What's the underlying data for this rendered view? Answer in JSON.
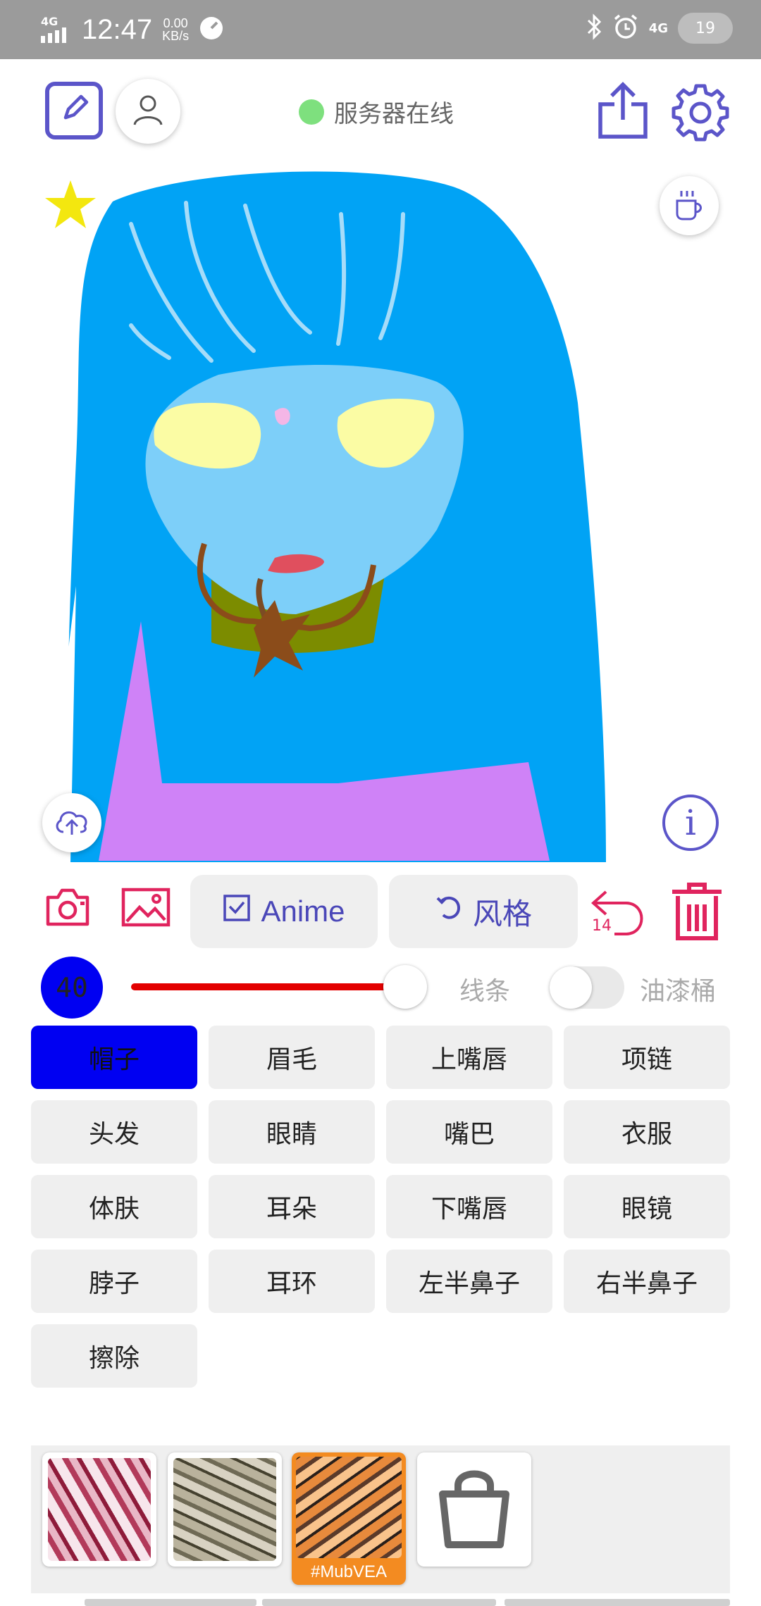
{
  "status_bar": {
    "network": "4G",
    "time": "12:47",
    "speed_value": "0.00",
    "speed_unit": "KB/s",
    "network_right": "4G",
    "battery": "19"
  },
  "header": {
    "server_status": "服务器在线",
    "online_color": "#7ee07e",
    "accent_color": "#5b55c9"
  },
  "toolbar": {
    "anime_label": "Anime",
    "style_label": "风格",
    "undo_count": "14"
  },
  "brush": {
    "size": "40",
    "slider_value": 0.72,
    "lines_label": "线条",
    "bucket_label": "油漆桶",
    "bucket_enabled": false
  },
  "parts": [
    {
      "label": "帽子",
      "active": true
    },
    {
      "label": "眉毛",
      "active": false
    },
    {
      "label": "上嘴唇",
      "active": false
    },
    {
      "label": "项链",
      "active": false
    },
    {
      "label": "头发",
      "active": false
    },
    {
      "label": "眼睛",
      "active": false
    },
    {
      "label": "嘴巴",
      "active": false
    },
    {
      "label": "衣服",
      "active": false
    },
    {
      "label": "体肤",
      "active": false
    },
    {
      "label": "耳朵",
      "active": false
    },
    {
      "label": "下嘴唇",
      "active": false
    },
    {
      "label": "眼镜",
      "active": false
    },
    {
      "label": "脖子",
      "active": false
    },
    {
      "label": "耳环",
      "active": false
    },
    {
      "label": "左半鼻子",
      "active": false
    },
    {
      "label": "右半鼻子",
      "active": false
    },
    {
      "label": "擦除",
      "active": false
    }
  ],
  "styles": {
    "selected_label": "#MubVEA"
  }
}
